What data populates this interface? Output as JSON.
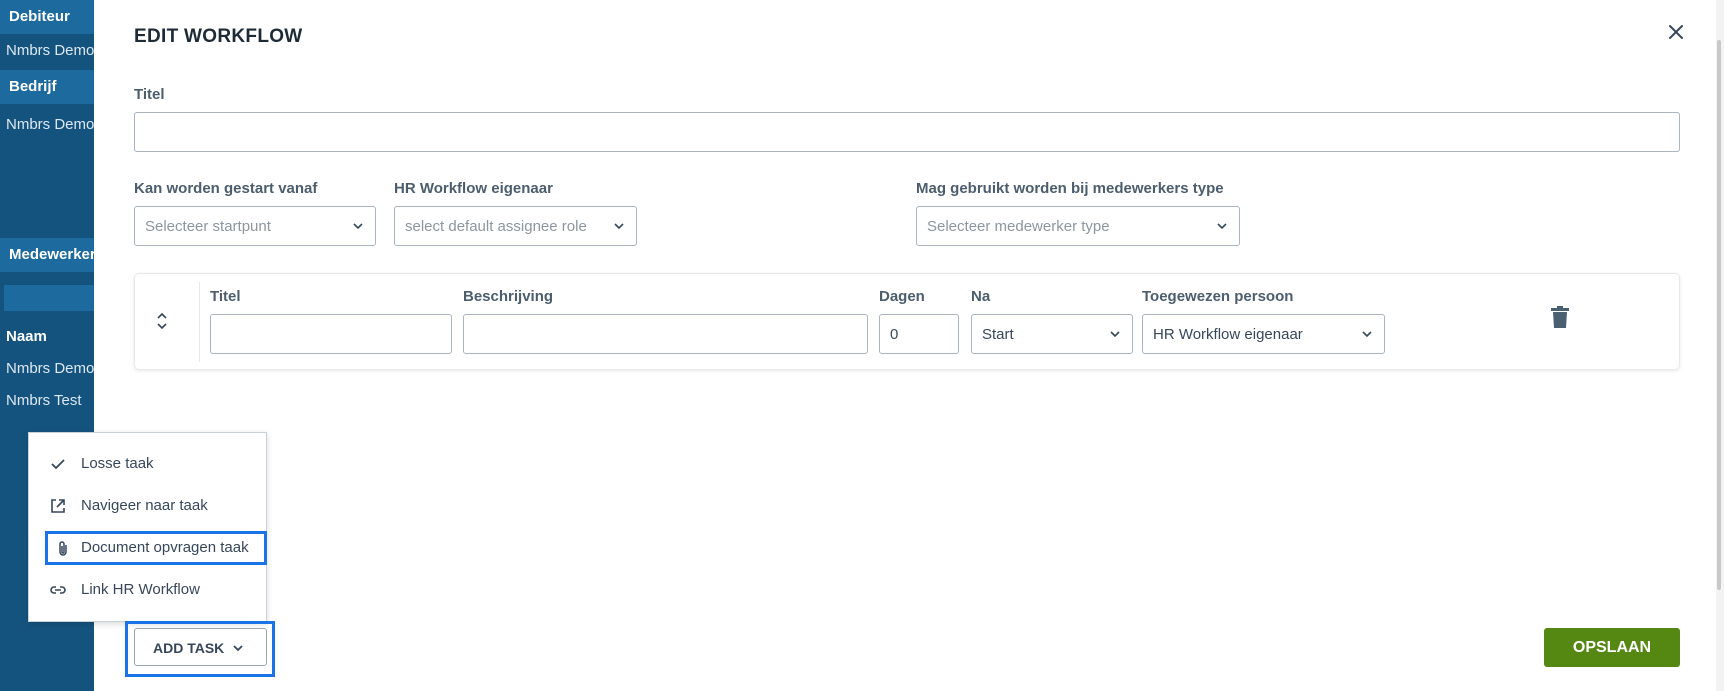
{
  "background": {
    "debiteur_header": "Debiteur",
    "debiteur_value": "Nmbrs Demo",
    "bedrijf_header": "Bedrijf",
    "bedrijf_value": "Nmbrs Demo",
    "medewerkers_header": "Medewerkers",
    "naam_header": "Naam",
    "rows": [
      "Nmbrs Demo",
      "Nmbrs Test"
    ]
  },
  "modal": {
    "title": "EDIT WORKFLOW",
    "titel_label": "Titel",
    "titel_value": "",
    "start_label": "Kan worden gestart vanaf",
    "start_placeholder": "Selecteer startpunt",
    "owner_label": "HR Workflow eigenaar",
    "owner_placeholder": "select default assignee role",
    "type_label": "Mag gebruikt worden bij medewerkers type",
    "type_placeholder": "Selecteer medewerker type"
  },
  "task": {
    "titel_label": "Titel",
    "titel_value": "",
    "beschrijving_label": "Beschrijving",
    "beschrijving_value": "",
    "dagen_label": "Dagen",
    "dagen_value": "0",
    "na_label": "Na",
    "na_value": "Start",
    "persoon_label": "Toegewezen persoon",
    "persoon_value": "HR Workflow eigenaar"
  },
  "menu": {
    "items": [
      {
        "label": "Losse taak",
        "icon": "check-icon"
      },
      {
        "label": "Navigeer naar taak",
        "icon": "external-link-icon"
      },
      {
        "label": "Document opvragen taak",
        "icon": "paperclip-icon"
      },
      {
        "label": "Link HR Workflow",
        "icon": "link-icon"
      }
    ]
  },
  "buttons": {
    "add_task": "ADD TASK",
    "save": "OPSLAAN"
  },
  "colors": {
    "sidebar": "#15537f",
    "highlight": "#1a73e8",
    "save": "#558713"
  }
}
